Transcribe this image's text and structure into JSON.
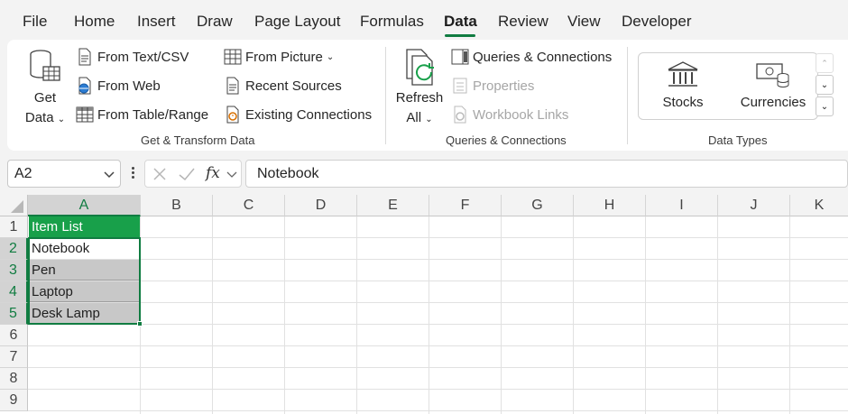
{
  "tabs": [
    {
      "label": "File",
      "active": false
    },
    {
      "label": "Home",
      "active": false
    },
    {
      "label": "Insert",
      "active": false
    },
    {
      "label": "Draw",
      "active": false
    },
    {
      "label": "Page Layout",
      "active": false
    },
    {
      "label": "Formulas",
      "active": false
    },
    {
      "label": "Data",
      "active": true
    },
    {
      "label": "Review",
      "active": false
    },
    {
      "label": "View",
      "active": false
    },
    {
      "label": "Developer",
      "active": false
    }
  ],
  "ribbon": {
    "get_transform": {
      "get_data_line1": "Get",
      "get_data_line2": "Data",
      "from_text_csv": "From Text/CSV",
      "from_web": "From Web",
      "from_table_range": "From Table/Range",
      "from_picture": "From Picture",
      "recent_sources": "Recent Sources",
      "existing_connections": "Existing Connections",
      "group_label": "Get & Transform Data"
    },
    "queries": {
      "refresh_line1": "Refresh",
      "refresh_line2": "All",
      "queries_connections": "Queries & Connections",
      "properties": "Properties",
      "workbook_links": "Workbook Links",
      "group_label": "Queries & Connections"
    },
    "data_types": {
      "stocks": "Stocks",
      "currencies": "Currencies",
      "group_label": "Data Types"
    }
  },
  "formula_bar": {
    "name_box": "A2",
    "fx_label": "fx",
    "value": "Notebook"
  },
  "sheet": {
    "columns": [
      "A",
      "B",
      "C",
      "D",
      "E",
      "F",
      "G",
      "H",
      "I",
      "J",
      "K"
    ],
    "rows": [
      "1",
      "2",
      "3",
      "4",
      "5",
      "6",
      "7",
      "8",
      "9"
    ],
    "cells": {
      "a1": "Item List",
      "a2": "Notebook",
      "a3": "Pen",
      "a4": "Laptop",
      "a5": "Desk Lamp"
    }
  },
  "colors": {
    "accent": "#107c41",
    "header_fill": "#18a04a",
    "selection_fill": "#c8c8c8"
  }
}
